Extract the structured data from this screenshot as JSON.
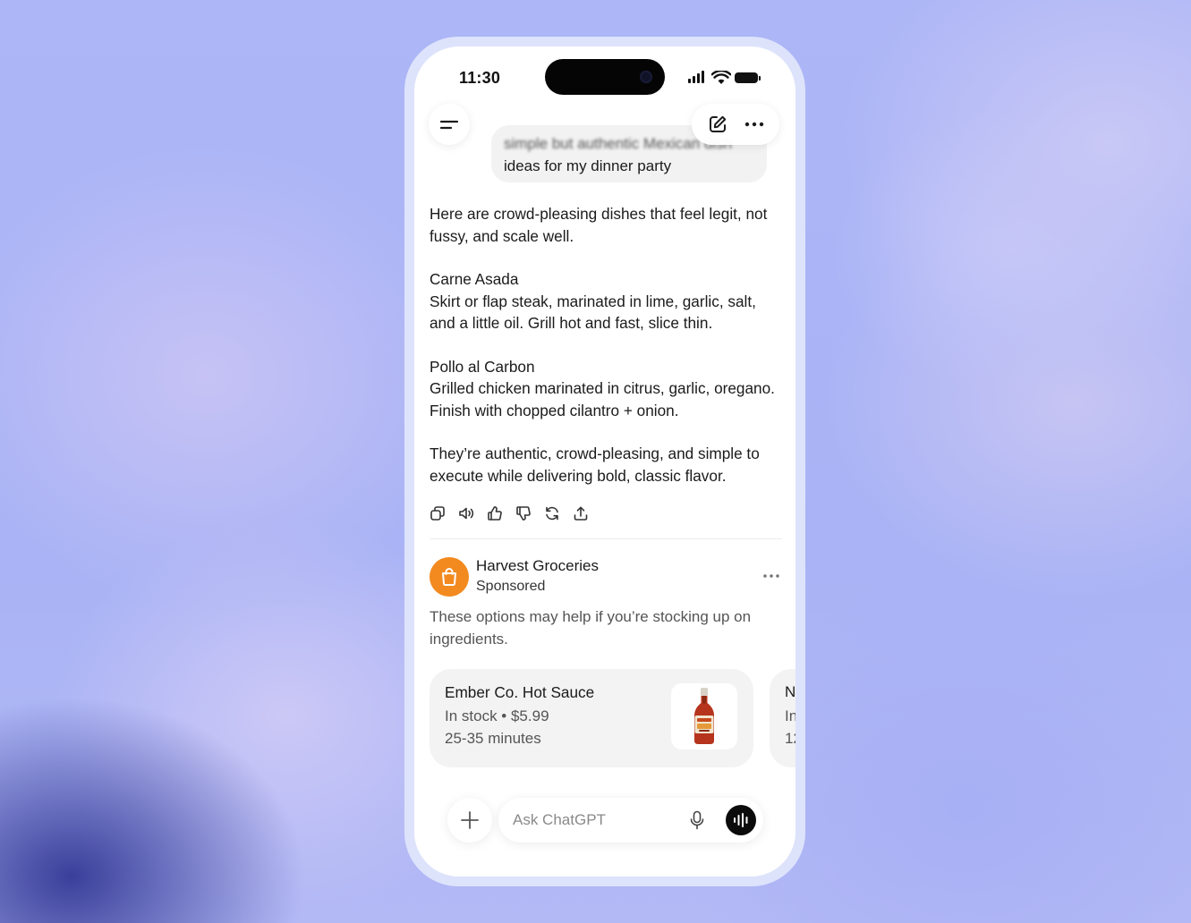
{
  "status_bar": {
    "time": "11:30"
  },
  "user_message": {
    "line1": "simple but authentic Mexican dish",
    "line2": "ideas for my dinner party"
  },
  "reply": {
    "intro": "Here are crowd-pleasing dishes that feel legit, not fussy, and scale well.",
    "dishes": [
      {
        "name": "Carne Asada",
        "desc": "Skirt or flap steak, marinated in lime, garlic, salt, and a little oil. Grill hot and fast, slice thin."
      },
      {
        "name": "Pollo al Carbon",
        "desc": "Grilled chicken marinated in citrus, garlic, oregano. Finish with chopped cilantro + onion."
      }
    ],
    "outro": "They’re authentic, crowd-pleasing, and simple to execute while delivering bold, classic flavor."
  },
  "message_actions": [
    "copy-icon",
    "read-aloud-icon",
    "thumbs-up-icon",
    "thumbs-down-icon",
    "regenerate-icon",
    "share-icon"
  ],
  "sponsor": {
    "name": "Harvest Groceries",
    "tag": "Sponsored",
    "text": "These options may help if you’re stocking up on ingredients.",
    "logo_color": "#f28a1f"
  },
  "products": [
    {
      "name": "Ember Co. Hot Sauce",
      "stock": "In stock • $5.99",
      "time": "25-35 minutes"
    },
    {
      "name": "N",
      "stock": "In",
      "time": "12"
    }
  ],
  "composer": {
    "placeholder": "Ask ChatGPT"
  }
}
